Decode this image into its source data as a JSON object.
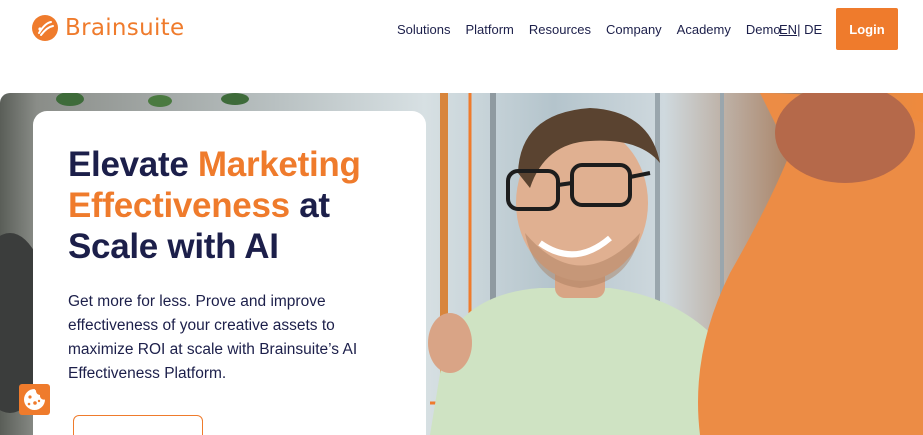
{
  "brand": {
    "name": "Brainsuite",
    "accent_color": "#ef7b2c",
    "text_color": "#1c1f4a"
  },
  "nav": {
    "items": [
      "Solutions",
      "Platform",
      "Resources",
      "Company",
      "Academy",
      "Demo"
    ],
    "lang_en": "EN",
    "lang_separator": "|",
    "lang_de": "DE",
    "login_label": "Login"
  },
  "hero": {
    "headline_part1": "Elevate ",
    "headline_accent": "Marketing Effectiveness",
    "headline_part2": " at Scale with AI",
    "subtext": "Get more for less. Prove and improve effectiveness of your creative assets to maximize ROI at scale with Brainsuite’s AI Effectiveness Platform.",
    "image": "smiling-man-with-glasses-photo"
  },
  "cookie": {
    "icon": "cookie-icon"
  }
}
